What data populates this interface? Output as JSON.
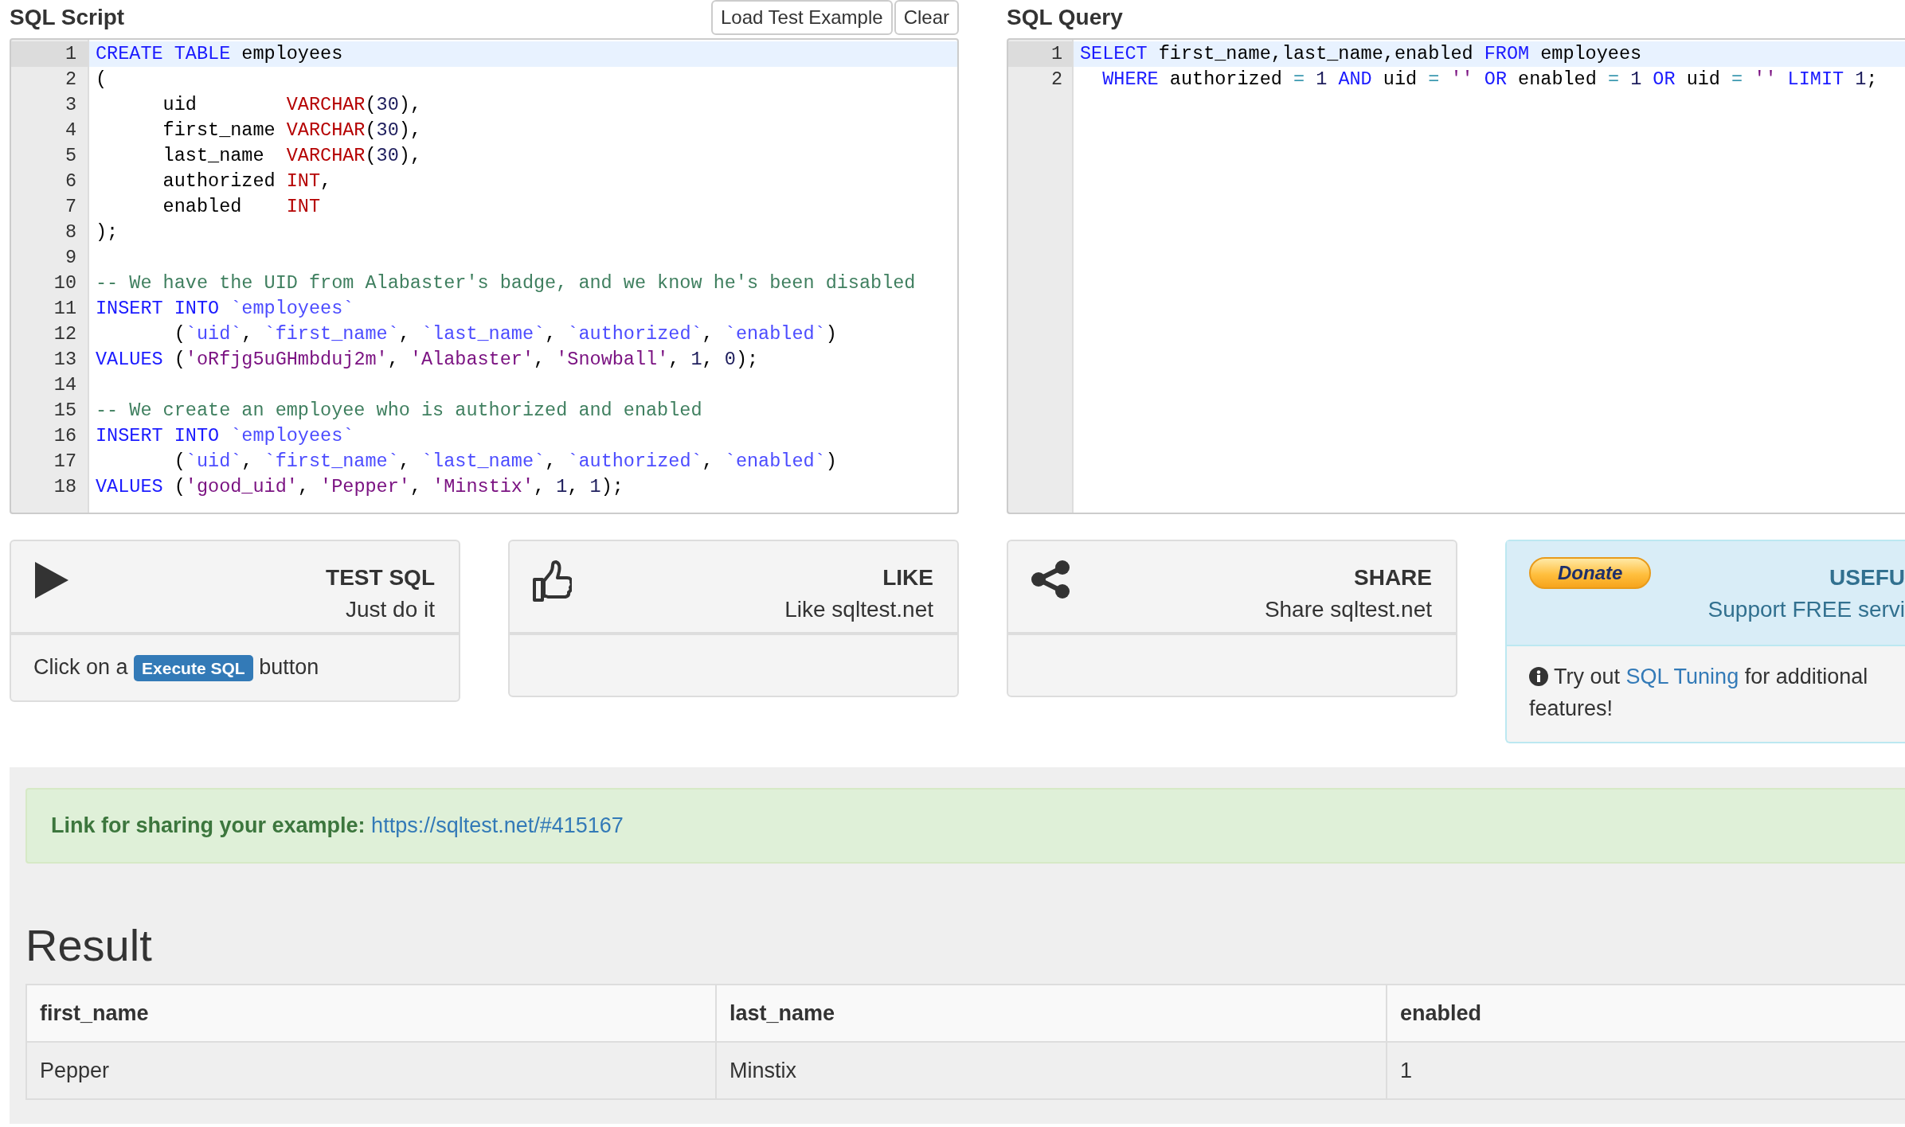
{
  "script": {
    "title": "SQL Script",
    "buttons": [
      "Load Test Example",
      "Clear"
    ],
    "lines": [
      {
        "number": "1",
        "selected": true,
        "tokens": [
          {
            "kind": "kw",
            "text": "CREATE"
          },
          {
            "kind": "kw",
            "text": " TABLE"
          },
          {
            "kind": "plain",
            "text": " employees"
          }
        ]
      },
      {
        "number": "2",
        "selected": false,
        "tokens": [
          {
            "kind": "plain",
            "text": "("
          }
        ]
      },
      {
        "number": "3",
        "selected": false,
        "tokens": [
          {
            "kind": "plain",
            "text": "      uid        "
          },
          {
            "kind": "type",
            "text": "VARCHAR"
          },
          {
            "kind": "plain",
            "text": "("
          },
          {
            "kind": "num",
            "text": "30"
          },
          {
            "kind": "plain",
            "text": "),"
          }
        ]
      },
      {
        "number": "4",
        "selected": false,
        "tokens": [
          {
            "kind": "plain",
            "text": "      first_name "
          },
          {
            "kind": "type",
            "text": "VARCHAR"
          },
          {
            "kind": "plain",
            "text": "("
          },
          {
            "kind": "num",
            "text": "30"
          },
          {
            "kind": "plain",
            "text": "),"
          }
        ]
      },
      {
        "number": "5",
        "selected": false,
        "tokens": [
          {
            "kind": "plain",
            "text": "      last_name  "
          },
          {
            "kind": "type",
            "text": "VARCHAR"
          },
          {
            "kind": "plain",
            "text": "("
          },
          {
            "kind": "num",
            "text": "30"
          },
          {
            "kind": "plain",
            "text": "),"
          }
        ]
      },
      {
        "number": "6",
        "selected": false,
        "tokens": [
          {
            "kind": "plain",
            "text": "      authorized "
          },
          {
            "kind": "type",
            "text": "INT"
          },
          {
            "kind": "plain",
            "text": ","
          }
        ]
      },
      {
        "number": "7",
        "selected": false,
        "tokens": [
          {
            "kind": "plain",
            "text": "      enabled    "
          },
          {
            "kind": "type",
            "text": "INT"
          }
        ]
      },
      {
        "number": "8",
        "selected": false,
        "tokens": [
          {
            "kind": "plain",
            "text": ");"
          }
        ]
      },
      {
        "number": "9",
        "selected": false
      },
      {
        "number": "10",
        "selected": false,
        "tokens": [
          {
            "kind": "comment",
            "text": "-- We have the UID from Alabaster's badge, and we know he's been disabled"
          }
        ]
      },
      {
        "number": "11",
        "selected": false,
        "tokens": [
          {
            "kind": "kw",
            "text": "INSERT"
          },
          {
            "kind": "kw",
            "text": " INTO"
          },
          {
            "kind": "bt",
            "text": " `employees`"
          }
        ]
      },
      {
        "number": "12",
        "selected": false,
        "tokens": [
          {
            "kind": "plain",
            "text": "       ("
          },
          {
            "kind": "bt",
            "text": "`uid`"
          },
          {
            "kind": "plain",
            "text": ","
          },
          {
            "kind": "bt",
            "text": " `first_name`"
          },
          {
            "kind": "plain",
            "text": ","
          },
          {
            "kind": "bt",
            "text": " `last_name`"
          },
          {
            "kind": "plain",
            "text": ","
          },
          {
            "kind": "bt",
            "text": " `authorized`"
          },
          {
            "kind": "plain",
            "text": ","
          },
          {
            "kind": "bt",
            "text": " `enabled`"
          },
          {
            "kind": "plain",
            "text": ")"
          }
        ]
      },
      {
        "number": "13",
        "selected": false,
        "tokens": [
          {
            "kind": "kw",
            "text": "VALUES"
          },
          {
            "kind": "plain",
            "text": " ("
          },
          {
            "kind": "str",
            "text": "'oRfjg5uGHmbduj2m'"
          },
          {
            "kind": "plain",
            "text": ","
          },
          {
            "kind": "str",
            "text": " 'Alabaster'"
          },
          {
            "kind": "plain",
            "text": ","
          },
          {
            "kind": "str",
            "text": " 'Snowball'"
          },
          {
            "kind": "plain",
            "text": ","
          },
          {
            "kind": "num",
            "text": " 1"
          },
          {
            "kind": "plain",
            "text": ","
          },
          {
            "kind": "num",
            "text": " 0"
          },
          {
            "kind": "plain",
            "text": ");"
          }
        ]
      },
      {
        "number": "14",
        "selected": false
      },
      {
        "number": "15",
        "selected": false,
        "tokens": [
          {
            "kind": "comment",
            "text": "-- We create an employee who is authorized and enabled"
          }
        ]
      },
      {
        "number": "16",
        "selected": false,
        "tokens": [
          {
            "kind": "kw",
            "text": "INSERT"
          },
          {
            "kind": "kw",
            "text": " INTO"
          },
          {
            "kind": "bt",
            "text": " `employees`"
          }
        ]
      },
      {
        "number": "17",
        "selected": false,
        "tokens": [
          {
            "kind": "plain",
            "text": "       ("
          },
          {
            "kind": "bt",
            "text": "`uid`"
          },
          {
            "kind": "plain",
            "text": ","
          },
          {
            "kind": "bt",
            "text": " `first_name`"
          },
          {
            "kind": "plain",
            "text": ","
          },
          {
            "kind": "bt",
            "text": " `last_name`"
          },
          {
            "kind": "plain",
            "text": ","
          },
          {
            "kind": "bt",
            "text": " `authorized`"
          },
          {
            "kind": "plain",
            "text": ","
          },
          {
            "kind": "bt",
            "text": " `enabled`"
          },
          {
            "kind": "plain",
            "text": ")"
          }
        ]
      },
      {
        "number": "18",
        "selected": false,
        "tokens": [
          {
            "kind": "kw",
            "text": "VALUES"
          },
          {
            "kind": "plain",
            "text": " ("
          },
          {
            "kind": "str",
            "text": "'good_uid'"
          },
          {
            "kind": "plain",
            "text": ","
          },
          {
            "kind": "str",
            "text": " 'Pepper'"
          },
          {
            "kind": "plain",
            "text": ","
          },
          {
            "kind": "str",
            "text": " 'Minstix'"
          },
          {
            "kind": "plain",
            "text": ","
          },
          {
            "kind": "num",
            "text": " 1"
          },
          {
            "kind": "plain",
            "text": ","
          },
          {
            "kind": "num",
            "text": " 1"
          },
          {
            "kind": "plain",
            "text": ");"
          }
        ]
      }
    ]
  },
  "query": {
    "title": "SQL Query",
    "lines": [
      {
        "number": "1",
        "selected": true,
        "tokens": [
          {
            "kind": "kw",
            "text": "SELECT"
          },
          {
            "kind": "plain",
            "text": " first_name,last_name,enabled"
          },
          {
            "kind": "kw",
            "text": " FROM"
          },
          {
            "kind": "plain",
            "text": " employees"
          }
        ]
      },
      {
        "number": "2",
        "selected": false,
        "tokens": [
          {
            "kind": "kw",
            "text": "  WHERE"
          },
          {
            "kind": "plain",
            "text": " authorized"
          },
          {
            "kind": "op",
            "text": " ="
          },
          {
            "kind": "num",
            "text": " 1"
          },
          {
            "kind": "kw",
            "text": " AND"
          },
          {
            "kind": "plain",
            "text": " uid"
          },
          {
            "kind": "op",
            "text": " ="
          },
          {
            "kind": "str",
            "text": " ''"
          },
          {
            "kind": "kw",
            "text": " OR"
          },
          {
            "kind": "plain",
            "text": " enabled"
          },
          {
            "kind": "op",
            "text": " ="
          },
          {
            "kind": "num",
            "text": " 1"
          },
          {
            "kind": "kw",
            "text": " OR"
          },
          {
            "kind": "plain",
            "text": " uid"
          },
          {
            "kind": "op",
            "text": " ="
          },
          {
            "kind": "str",
            "text": " ''"
          },
          {
            "kind": "kw",
            "text": " LIMIT"
          },
          {
            "kind": "num",
            "text": " 1"
          },
          {
            "kind": "plain",
            "text": ";"
          }
        ]
      }
    ]
  },
  "cards": [
    {
      "kind": "run",
      "title": "TEST SQL",
      "subtitle": "Just do it",
      "footer": {
        "before": "Click on a",
        "badge": "Execute SQL",
        "after": "button"
      }
    },
    {
      "kind": "like",
      "title": "LIKE",
      "subtitle": "Like sqltest.net"
    },
    {
      "kind": "share",
      "title": "SHARE",
      "subtitle": "Share sqltest.net"
    },
    {
      "kind": "donate",
      "button": "Donate",
      "title": "USEFU",
      "subtitle": "Support FREE servi",
      "footer": {
        "before": "Try out",
        "link": "SQL Tuning",
        "after": "for additional features!"
      }
    }
  ],
  "share_alert": {
    "label": "Link for sharing your example:",
    "link": "https://sqltest.net/#415167"
  },
  "result": {
    "title": "Result",
    "columns": [
      "first_name",
      "last_name",
      "enabled"
    ],
    "rows": [
      [
        "Pepper",
        "Minstix",
        "1"
      ]
    ]
  }
}
